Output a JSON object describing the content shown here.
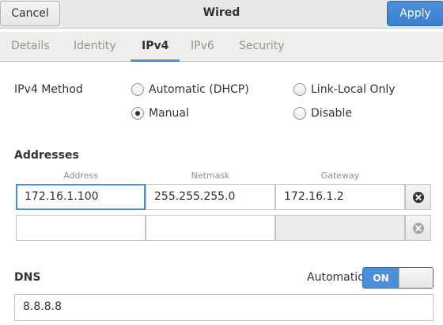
{
  "header": {
    "cancel_label": "Cancel",
    "title": "Wired",
    "apply_label": "Apply"
  },
  "tabs": [
    {
      "label": "Details",
      "active": false
    },
    {
      "label": "Identity",
      "active": false
    },
    {
      "label": "IPv4",
      "active": true
    },
    {
      "label": "IPv6",
      "active": false
    },
    {
      "label": "Security",
      "active": false
    }
  ],
  "ipv4_method": {
    "label": "IPv4 Method",
    "options": [
      {
        "label": "Automatic (DHCP)",
        "checked": false
      },
      {
        "label": "Link-Local Only",
        "checked": false
      },
      {
        "label": "Manual",
        "checked": true
      },
      {
        "label": "Disable",
        "checked": false
      }
    ]
  },
  "addresses": {
    "label": "Addresses",
    "columns": [
      "Address",
      "Netmask",
      "Gateway"
    ],
    "rows": [
      {
        "address": "172.16.1.100",
        "netmask": "255.255.255.0",
        "gateway": "172.16.1.2"
      },
      {
        "address": "",
        "netmask": "",
        "gateway": ""
      }
    ]
  },
  "dns": {
    "label": "DNS",
    "automatic_label": "Automatic",
    "switch_label": "ON",
    "switch_on": true,
    "value": "8.8.8.8"
  },
  "colors": {
    "accent": "#4a90d9",
    "text": "#2e3436",
    "muted": "#93968f"
  }
}
